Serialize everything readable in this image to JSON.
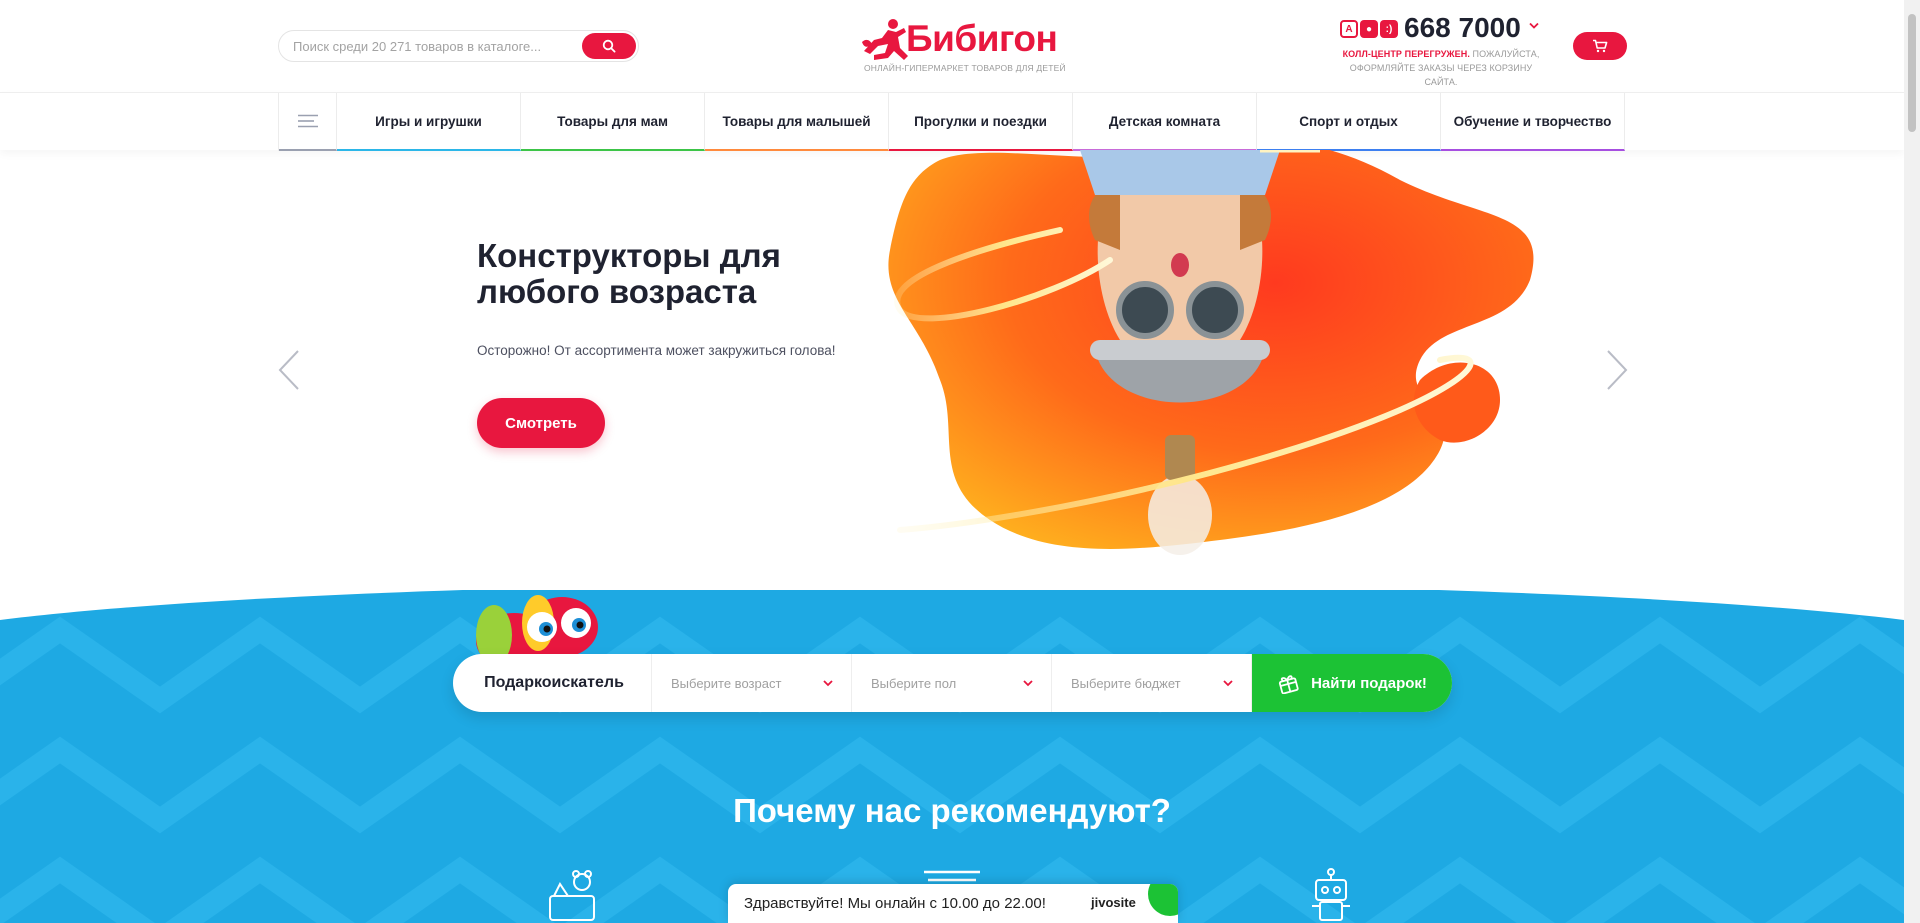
{
  "header": {
    "search_placeholder": "Поиск среди 20 271 товаров в каталоге...",
    "logo_text": "Бибигон",
    "logo_subtitle": "ОНЛАЙН-ГИПЕРМАРКЕТ ТОВАРОВ ДЛЯ ДЕТЕЙ",
    "operators": [
      "A",
      "●",
      ":)"
    ],
    "phone": "668 7000",
    "notice_bold": "КОЛЛ-ЦЕНТР ПЕРЕГРУЖЕН.",
    "notice_rest": " ПОЖАЛУЙСТА,",
    "notice_line2": "ОФОРМЛЯЙТЕ ЗАКАЗЫ ЧЕРЕЗ КОРЗИНУ САЙТА."
  },
  "nav": {
    "items": [
      {
        "label": "Игры и игрушки",
        "color": "#2bb6e8"
      },
      {
        "label": "Товары для мам",
        "color": "#3cc447"
      },
      {
        "label": "Товары для малышей",
        "color": "#ff8a3d"
      },
      {
        "label": "Прогулки и поездки",
        "color": "#e8173f"
      },
      {
        "label": "Детская комната",
        "color": "#c86bd9"
      },
      {
        "label": "Спорт и отдых",
        "color": "#3d7ff0"
      },
      {
        "label": "Обучение и творчество",
        "color": "#a64ee0"
      }
    ]
  },
  "hero": {
    "title": "Конструкторы для любого возраста",
    "subtitle": "Осторожно! От ассортимента может закружиться голова!",
    "button": "Смотреть"
  },
  "gift_finder": {
    "label": "Подаркоискатель",
    "age_placeholder": "Выберите возраст",
    "gender_placeholder": "Выберите пол",
    "budget_placeholder": "Выберите бюджет",
    "button": "Найти подарок!"
  },
  "why": {
    "title": "Почему нас рекомендуют?"
  },
  "chat": {
    "text": "Здравствуйте! Мы онлайн с 10.00 до 22.00!",
    "brand": "jivosite"
  },
  "colors": {
    "accent": "#e8173f",
    "green": "#1cc235",
    "blue": "#1ea9e3"
  }
}
